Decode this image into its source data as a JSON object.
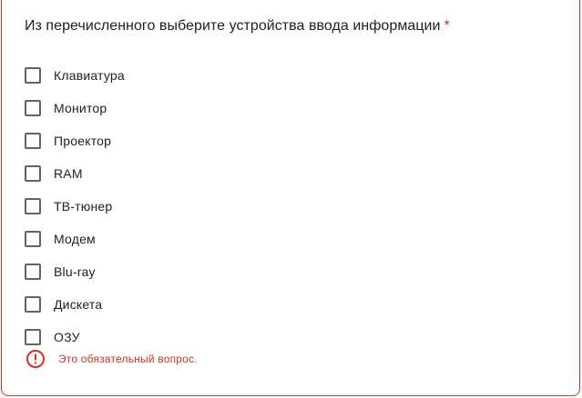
{
  "question": {
    "title": "Из перечисленного выберите устройства ввода информации",
    "required_mark": "*"
  },
  "options": [
    {
      "label": "Клавиатура",
      "checked": false
    },
    {
      "label": "Монитор",
      "checked": false
    },
    {
      "label": "Проектор",
      "checked": false
    },
    {
      "label": "RAM",
      "checked": false
    },
    {
      "label": "ТВ-тюнер",
      "checked": false
    },
    {
      "label": "Модем",
      "checked": false
    },
    {
      "label": "Blu-ray",
      "checked": false
    },
    {
      "label": "Дискета",
      "checked": false
    },
    {
      "label": "ОЗУ",
      "checked": false
    }
  ],
  "error": {
    "icon": "error-circle-icon",
    "message": "Это обязательный вопрос."
  },
  "colors": {
    "error_red": "#d93025",
    "text": "#202124",
    "checkbox_border": "#5f6368"
  }
}
